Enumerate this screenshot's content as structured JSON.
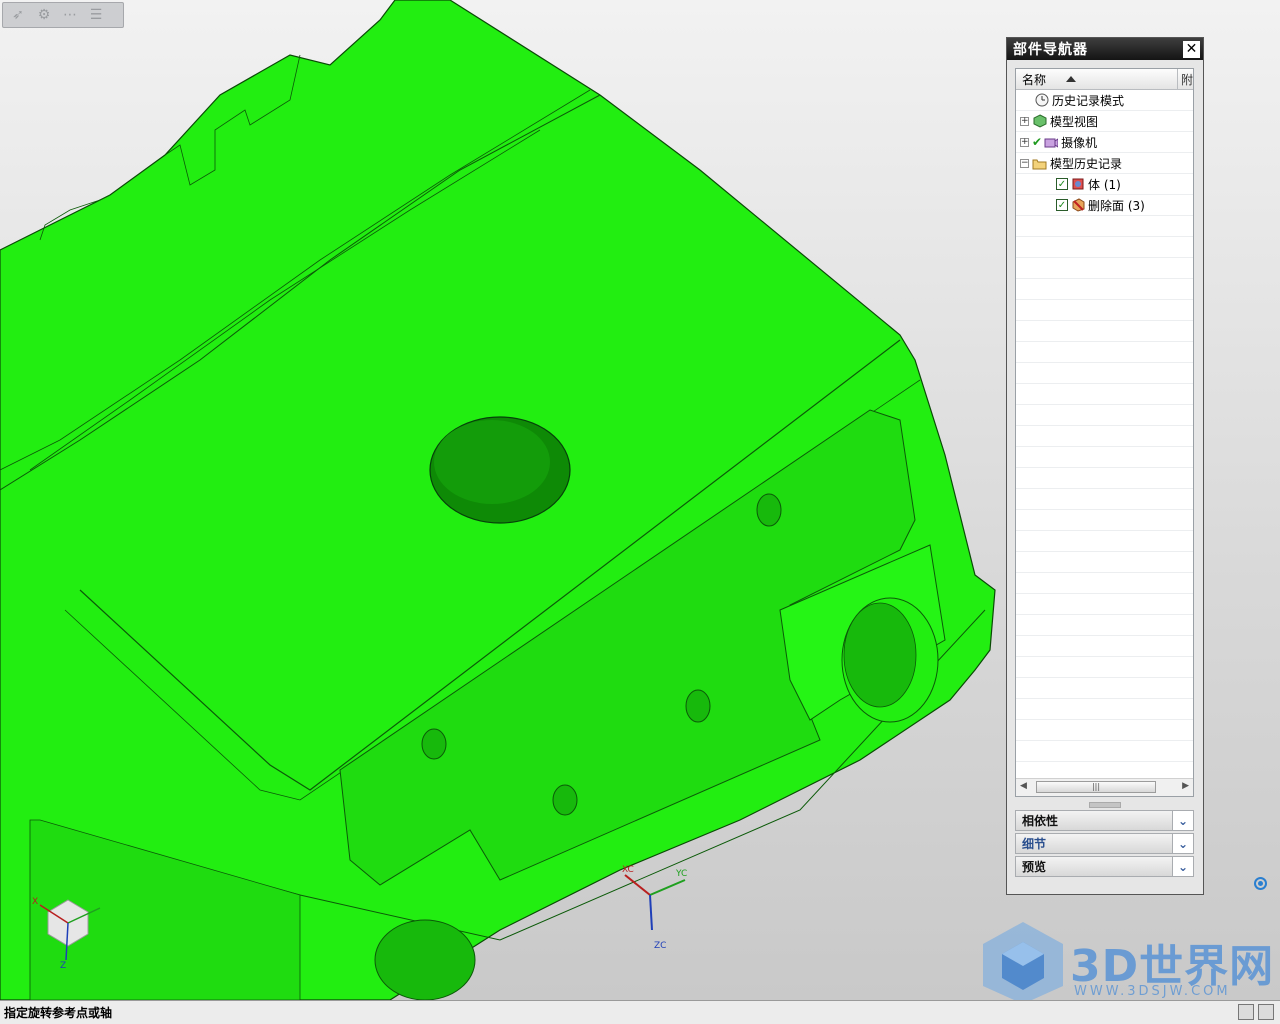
{
  "navigator": {
    "title": "部件导航器",
    "close_glyph": "✕",
    "column_name": "名称",
    "column_extra": "附",
    "tree": [
      {
        "label": "历史记录模式",
        "icon": "clock-icon"
      },
      {
        "label": "模型视图",
        "icon": "model-view-icon",
        "expander": "+"
      },
      {
        "label": "摄像机",
        "icon": "camera-icon",
        "expander": "+",
        "check": "✔"
      },
      {
        "label": "模型历史记录",
        "icon": "folder-icon",
        "expander": "−"
      },
      {
        "label": "体 (1)",
        "icon": "body-feature-icon",
        "checked": true
      },
      {
        "label": "删除面 (3)",
        "icon": "delete-face-icon",
        "checked": true
      }
    ],
    "sections": [
      {
        "label": "相依性"
      },
      {
        "label": "细节"
      },
      {
        "label": "预览"
      }
    ]
  },
  "viewport": {
    "wcs_labels": [
      "XC",
      "YC",
      "ZC"
    ],
    "triad_labels": [
      "X",
      "Z"
    ],
    "model_color": "#22ee11"
  },
  "status": {
    "text": "指定旋转参考点或轴"
  },
  "watermark": {
    "brand": "3D世界网",
    "url": "WWW.3DSJW.COM"
  },
  "colors": {
    "navigator_title_bg": "#1e1e1e",
    "accent_blue": "#3a5f9e"
  }
}
